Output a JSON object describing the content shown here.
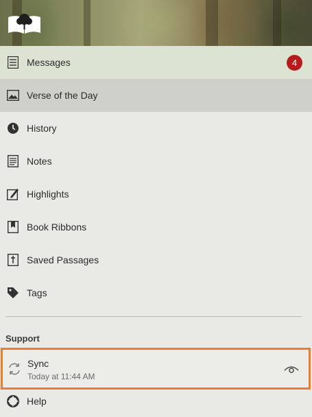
{
  "header": {
    "logo_icon": "open-bible-tree-logo"
  },
  "menu": {
    "items": [
      {
        "label": "Messages",
        "icon": "messages-icon",
        "badge": "4"
      },
      {
        "label": "Verse of the Day",
        "icon": "image-icon"
      },
      {
        "label": "History",
        "icon": "clock-icon"
      },
      {
        "label": "Notes",
        "icon": "notes-icon"
      },
      {
        "label": "Highlights",
        "icon": "pencil-icon"
      },
      {
        "label": "Book Ribbons",
        "icon": "bookmark-icon"
      },
      {
        "label": "Saved Passages",
        "icon": "bible-cross-icon"
      },
      {
        "label": "Tags",
        "icon": "tag-icon"
      }
    ]
  },
  "support": {
    "title": "Support",
    "sync": {
      "label": "Sync",
      "status": "Today at 11:44 AM",
      "icon": "sync-icon",
      "action_icon": "eye-icon"
    },
    "help": {
      "label": "Help",
      "icon": "lifebuoy-icon"
    }
  },
  "colors": {
    "badge": "#b71c1c",
    "highlight_border": "#f07a2c",
    "active_bg": "#cfd0ca"
  }
}
